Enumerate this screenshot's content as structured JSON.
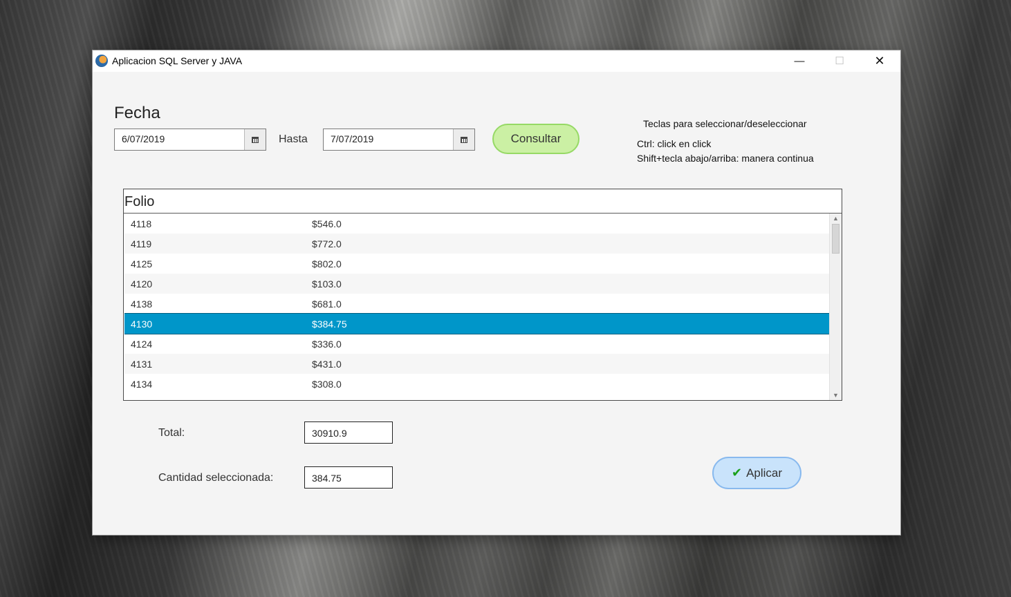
{
  "window": {
    "title": "Aplicacion SQL Server y JAVA",
    "controls": {
      "minimize": "—",
      "maximize": "☐",
      "close": "✕"
    }
  },
  "filters": {
    "fecha_label": "Fecha",
    "date_from": "6/07/2019",
    "hasta_label": "Hasta",
    "date_to": "7/07/2019",
    "consultar_label": "Consultar"
  },
  "hints": {
    "title": "Teclas para seleccionar/deseleccionar",
    "line1": "Ctrl: click en click",
    "line2": "Shift+tecla abajo/arriba: manera continua"
  },
  "table": {
    "header": "Folio",
    "rows": [
      {
        "folio": "4118",
        "amount": "$546.0"
      },
      {
        "folio": "4119",
        "amount": "$772.0"
      },
      {
        "folio": "4125",
        "amount": "$802.0"
      },
      {
        "folio": "4120",
        "amount": "$103.0"
      },
      {
        "folio": "4138",
        "amount": "$681.0"
      },
      {
        "folio": "4130",
        "amount": "$384.75"
      },
      {
        "folio": "4124",
        "amount": "$336.0"
      },
      {
        "folio": "4131",
        "amount": "$431.0"
      },
      {
        "folio": "4134",
        "amount": "$308.0"
      }
    ],
    "selected_index": 5
  },
  "summary": {
    "total_label": "Total:",
    "total_value": "30910.9",
    "cantidad_label": "Cantidad seleccionada:",
    "cantidad_value": "384.75"
  },
  "actions": {
    "aplicar_label": "Aplicar"
  },
  "colors": {
    "selected_row": "#0096c9",
    "consultar_bg": "#cbf0a4",
    "aplicar_bg": "#c9e3fb"
  }
}
